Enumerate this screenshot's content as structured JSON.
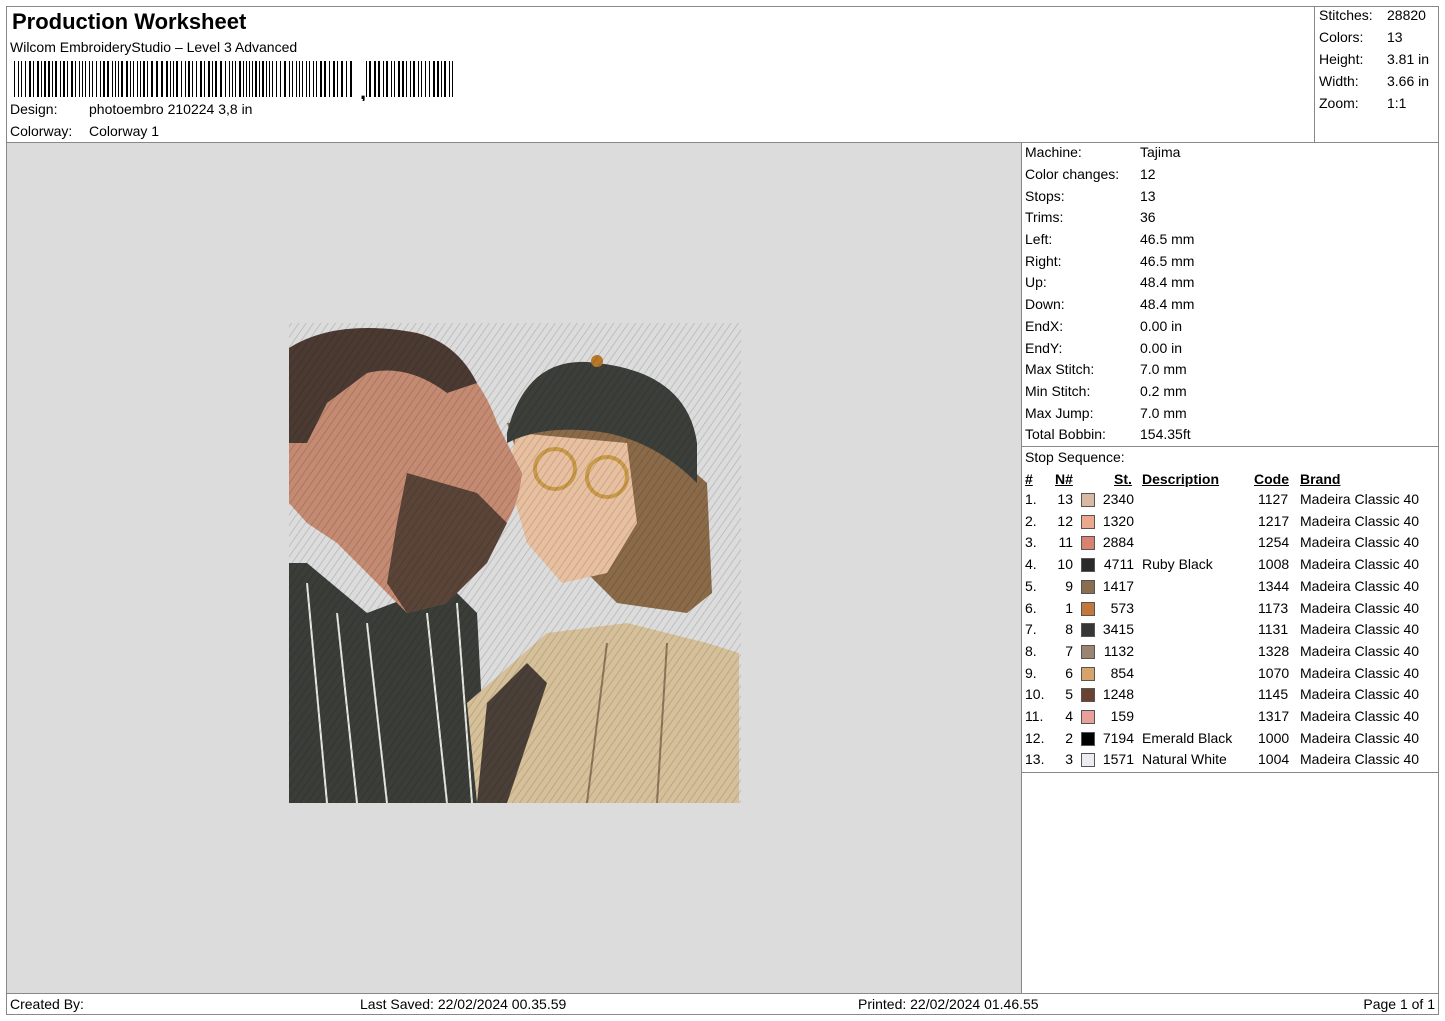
{
  "header": {
    "title": "Production Worksheet",
    "subtitle": "Wilcom EmbroideryStudio – Level 3 Advanced",
    "design_label": "Design:",
    "design_value": "photoembro 210224 3,8 in",
    "colorway_label": "Colorway:",
    "colorway_value": "Colorway 1"
  },
  "summary": [
    {
      "label": "Stitches:",
      "value": "28820"
    },
    {
      "label": "Colors:",
      "value": "13"
    },
    {
      "label": "Height:",
      "value": "3.81 in"
    },
    {
      "label": "Width:",
      "value": "3.66 in"
    },
    {
      "label": "Zoom:",
      "value": "1:1"
    }
  ],
  "properties": [
    {
      "label": "Machine:",
      "value": "Tajima"
    },
    {
      "label": "Color changes:",
      "value": "12"
    },
    {
      "label": "Stops:",
      "value": "13"
    },
    {
      "label": "Trims:",
      "value": "36"
    },
    {
      "label": "Left:",
      "value": "46.5 mm"
    },
    {
      "label": "Right:",
      "value": "46.5 mm"
    },
    {
      "label": "Up:",
      "value": "48.4 mm"
    },
    {
      "label": "Down:",
      "value": "48.4 mm"
    },
    {
      "label": "EndX:",
      "value": "0.00 in"
    },
    {
      "label": "EndY:",
      "value": "0.00 in"
    },
    {
      "label": "Max Stitch:",
      "value": "7.0 mm"
    },
    {
      "label": "Min Stitch:",
      "value": "0.2 mm"
    },
    {
      "label": "Max Jump:",
      "value": "7.0 mm"
    },
    {
      "label": "Total Bobbin:",
      "value": "154.35ft"
    }
  ],
  "stop_sequence": {
    "title": "Stop Sequence:",
    "headers": {
      "num": "#",
      "n": "N#",
      "st": "St.",
      "description": "Description",
      "code": "Code",
      "brand": "Brand"
    },
    "rows": [
      {
        "num": "1.",
        "n": "13",
        "color": "#d9b9a3",
        "st": "2340",
        "description": "",
        "code": "1127",
        "brand": "Madeira Classic 40"
      },
      {
        "num": "2.",
        "n": "12",
        "color": "#eaa98d",
        "st": "1320",
        "description": "",
        "code": "1217",
        "brand": "Madeira Classic 40"
      },
      {
        "num": "3.",
        "n": "11",
        "color": "#d98272",
        "st": "2884",
        "description": "",
        "code": "1254",
        "brand": "Madeira Classic 40"
      },
      {
        "num": "4.",
        "n": "10",
        "color": "#2a2a28",
        "st": "4711",
        "description": "Ruby Black",
        "code": "1008",
        "brand": "Madeira Classic 40"
      },
      {
        "num": "5.",
        "n": "9",
        "color": "#8a6e52",
        "st": "1417",
        "description": "",
        "code": "1344",
        "brand": "Madeira Classic 40"
      },
      {
        "num": "6.",
        "n": "1",
        "color": "#c2783a",
        "st": "573",
        "description": "",
        "code": "1173",
        "brand": "Madeira Classic 40"
      },
      {
        "num": "7.",
        "n": "8",
        "color": "#383634",
        "st": "3415",
        "description": "",
        "code": "1131",
        "brand": "Madeira Classic 40"
      },
      {
        "num": "8.",
        "n": "7",
        "color": "#9a8472",
        "st": "1132",
        "description": "",
        "code": "1328",
        "brand": "Madeira Classic 40"
      },
      {
        "num": "9.",
        "n": "6",
        "color": "#d6a46a",
        "st": "854",
        "description": "",
        "code": "1070",
        "brand": "Madeira Classic 40"
      },
      {
        "num": "10.",
        "n": "5",
        "color": "#6a4232",
        "st": "1248",
        "description": "",
        "code": "1145",
        "brand": "Madeira Classic 40"
      },
      {
        "num": "11.",
        "n": "4",
        "color": "#e8a09a",
        "st": "159",
        "description": "",
        "code": "1317",
        "brand": "Madeira Classic 40"
      },
      {
        "num": "12.",
        "n": "2",
        "color": "#000000",
        "st": "7194",
        "description": "Emerald Black",
        "code": "1000",
        "brand": "Madeira Classic 40"
      },
      {
        "num": "13.",
        "n": "3",
        "color": "#ececf2",
        "st": "1571",
        "description": "Natural White",
        "code": "1004",
        "brand": "Madeira Classic 40"
      }
    ]
  },
  "footer": {
    "created_by": "Created By:",
    "last_saved": "Last Saved: 22/02/2024 00.35.59",
    "printed": "Printed: 22/02/2024 01.46.55",
    "page": "Page 1 of 1"
  }
}
